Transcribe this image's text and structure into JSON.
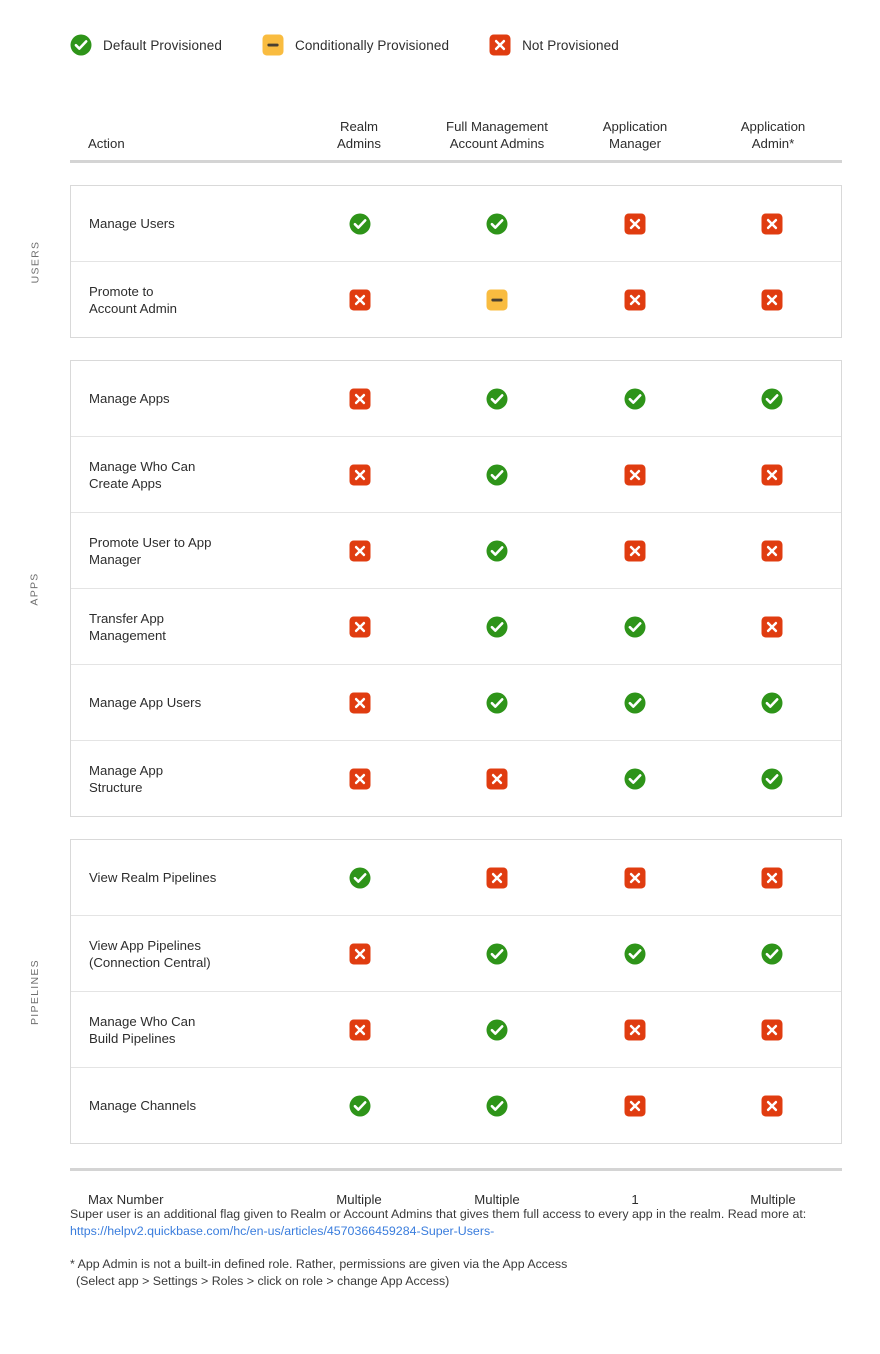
{
  "legend": {
    "items": [
      {
        "icon": "check-circle-icon",
        "label": "Default Provisioned",
        "color": "#2e9419"
      },
      {
        "icon": "dash-square-icon",
        "label": "Conditionally Provisioned",
        "color": "#f9bc40"
      },
      {
        "icon": "x-square-icon",
        "label": "Not Provisioned",
        "color": "#e03c10"
      }
    ]
  },
  "table": {
    "headers": {
      "action": "Action",
      "columns": [
        {
          "line1": "Realm",
          "line2": "Admins"
        },
        {
          "line1": "Full Management",
          "line2": "Account Admins"
        },
        {
          "line1": "Application",
          "line2": "Manager"
        },
        {
          "line1": "Application",
          "line2": "Admin*"
        }
      ]
    },
    "sections": [
      {
        "side_label": "USERS",
        "rows": [
          {
            "label_line1": "Manage Users",
            "label_line2": "",
            "values": [
              "yes",
              "yes",
              "no",
              "no"
            ]
          },
          {
            "label_line1": "Promote to",
            "label_line2": "Account Admin",
            "values": [
              "no",
              "maybe",
              "no",
              "no"
            ]
          }
        ]
      },
      {
        "side_label": "APPS",
        "rows": [
          {
            "label_line1": "Manage Apps",
            "label_line2": "",
            "values": [
              "no",
              "yes",
              "yes",
              "yes"
            ]
          },
          {
            "label_line1": "Manage Who Can",
            "label_line2": "Create Apps",
            "values": [
              "no",
              "yes",
              "no",
              "no"
            ]
          },
          {
            "label_line1": "Promote User to App",
            "label_line2": "Manager",
            "values": [
              "no",
              "yes",
              "no",
              "no"
            ]
          },
          {
            "label_line1": "Transfer App",
            "label_line2": "Management",
            "values": [
              "no",
              "yes",
              "yes",
              "no"
            ]
          },
          {
            "label_line1": "Manage App Users",
            "label_line2": "",
            "values": [
              "no",
              "yes",
              "yes",
              "yes"
            ]
          },
          {
            "label_line1": "Manage App",
            "label_line2": "Structure",
            "values": [
              "no",
              "no",
              "yes",
              "yes"
            ]
          }
        ]
      },
      {
        "side_label": "PIPELINES",
        "rows": [
          {
            "label_line1": "View Realm Pipelines",
            "label_line2": "",
            "values": [
              "yes",
              "no",
              "no",
              "no"
            ]
          },
          {
            "label_line1": "View App Pipelines",
            "label_line2": "(Connection Central)",
            "values": [
              "no",
              "yes",
              "yes",
              "yes"
            ]
          },
          {
            "label_line1": "Manage Who Can",
            "label_line2": "Build Pipelines",
            "values": [
              "no",
              "yes",
              "no",
              "no"
            ]
          },
          {
            "label_line1": "Manage Channels",
            "label_line2": "",
            "values": [
              "yes",
              "yes",
              "no",
              "no"
            ]
          }
        ]
      }
    ],
    "max_number": {
      "label": "Max Number",
      "values": [
        "Multiple",
        "Multiple",
        "1",
        "Multiple"
      ]
    }
  },
  "notes": {
    "super_user_text": "Super user is an additional flag given to Realm or Account Admins that gives them full access to every app in the realm. Read more at: ",
    "super_user_link": "https://helpv2.quickbase.com/hc/en-us/articles/4570366459284-Super-Users-",
    "app_admin_line1": "* App Admin is not a built-in defined role. Rather, permissions are given via the App Access",
    "app_admin_line2": "(Select app > Settings > Roles > click on role > change App Access)"
  },
  "colors": {
    "yes": "#2e9419",
    "maybe": "#f9bc40",
    "no": "#e03c10",
    "link": "#3a7ddd"
  }
}
